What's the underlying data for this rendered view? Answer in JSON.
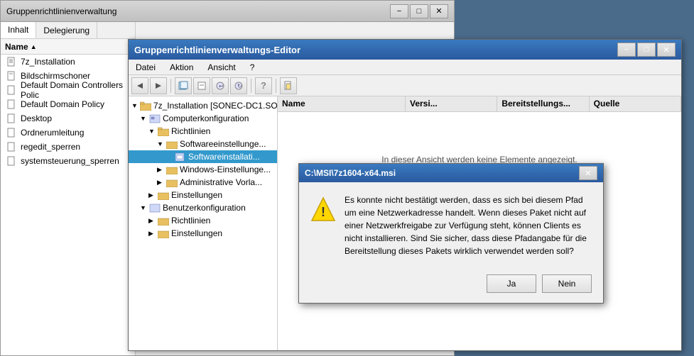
{
  "mainWindow": {
    "title": "Gruppenrichtlinienverwaltung",
    "controls": {
      "minimize": "−",
      "maximize": "□",
      "close": "✕"
    }
  },
  "leftPanel": {
    "tabs": [
      {
        "label": "Inhalt",
        "active": true
      },
      {
        "label": "Delegierung",
        "active": false
      }
    ],
    "columnHeader": "Name",
    "items": [
      {
        "label": "7z_Installation",
        "icon": "document"
      },
      {
        "label": "Bildschirmschoner",
        "icon": "document"
      },
      {
        "label": "Default Domain Controllers Polic",
        "icon": "document"
      },
      {
        "label": "Default Domain Policy",
        "icon": "document"
      },
      {
        "label": "Desktop",
        "icon": "document"
      },
      {
        "label": "Ordnerumleitung",
        "icon": "document"
      },
      {
        "label": "regedit_sperren",
        "icon": "document"
      },
      {
        "label": "systemsteuerung_sperren",
        "icon": "document"
      }
    ]
  },
  "editorWindow": {
    "title": "Gruppenrichtlinienverwaltungs-Editor",
    "controls": {
      "minimize": "−",
      "maximize": "□",
      "close": "✕"
    },
    "menu": [
      "Datei",
      "Aktion",
      "Ansicht",
      "?"
    ],
    "toolbar": {
      "buttons": [
        "◀",
        "▶",
        "📋",
        "🗑",
        "↩",
        "↻",
        "?",
        "📄"
      ]
    },
    "breadcrumb": "7z_Installation [SONEC-DC1.SO...",
    "tree": [
      {
        "label": "7z_Installation [SONEC-DC1.SO...",
        "indent": 1,
        "expanded": true
      },
      {
        "label": "Computerkonfiguration",
        "indent": 2,
        "expanded": true
      },
      {
        "label": "Richtlinien",
        "indent": 3,
        "expanded": true
      },
      {
        "label": "Softwareeinstellunge...",
        "indent": 4,
        "expanded": true
      },
      {
        "label": "Softwareinstallati...",
        "indent": 5,
        "selected": true
      },
      {
        "label": "Windows-Einstellunge...",
        "indent": 4,
        "expanded": false
      },
      {
        "label": "Administrative Vorla...",
        "indent": 4,
        "expanded": false
      },
      {
        "label": "Einstellungen",
        "indent": 3,
        "expanded": false
      },
      {
        "label": "Benutzerkonfiguration",
        "indent": 2,
        "expanded": true
      },
      {
        "label": "Richtlinien",
        "indent": 3,
        "expanded": false
      },
      {
        "label": "Einstellungen",
        "indent": 3,
        "expanded": false
      }
    ],
    "columns": [
      "Name",
      "Versi...",
      "Bereitstellungs...",
      "Quelle"
    ],
    "emptyMessage": "In dieser Ansicht werden keine Elemente angezeigt."
  },
  "dialog": {
    "title": "C:\\MSI\\7z1604-x64.msi",
    "closeBtn": "✕",
    "message": "Es konnte nicht bestätigt werden, dass es sich bei diesem Pfad um eine Netzwerkadresse handelt. Wenn dieses Paket nicht auf einer Netzwerkfreigabe zur Verfügung steht, können Clients es nicht installieren. Sind Sie sicher, dass diese Pfadangabe für die Bereitstellung dieses Pakets wirklich verwendet werden soll?",
    "buttons": {
      "yes": "Ja",
      "no": "Nein"
    }
  }
}
